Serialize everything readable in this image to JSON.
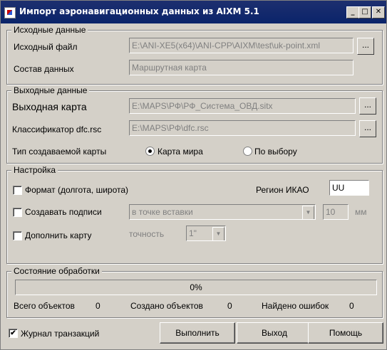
{
  "window": {
    "title": "Импорт аэронавигационных данных из AIXM 5.1",
    "controls": {
      "minimize": "_",
      "maximize": "□",
      "close": "✕"
    }
  },
  "source": {
    "group_label": "Исходные данные",
    "file_label": "Исходный файл",
    "file_value": "E:\\ANI-XE5(x64)\\ANI-CPP\\AIXM\\test\\uk-point.xml",
    "composition_label": "Состав данных",
    "composition_value": "Маршрутная карта",
    "browse_label": "..."
  },
  "output": {
    "group_label": "Выходные данные",
    "map_label": "Выходная карта",
    "map_value": "E:\\MAPS\\РФ\\РФ_Система_ОВД.sitx",
    "classifier_label": "Классификатор dfc.rsc",
    "classifier_value": "E:\\MAPS\\РФ\\dfc.rsc",
    "browse_label": "...",
    "map_type_label": "Тип создаваемой карты",
    "map_type_options": [
      "Карта мира",
      "По выбору"
    ],
    "map_type_selected": "Карта мира"
  },
  "settings": {
    "group_label": "Настройка",
    "format_label": "Формат (долгота, широта)",
    "format_checked": false,
    "region_label": "Регион ИКАО",
    "region_value": "UU",
    "labels_label": "Создавать подписи",
    "labels_checked": false,
    "labels_position": "в точке вставки",
    "labels_size": "10",
    "labels_unit": "мм",
    "supplement_label": "Дополнить карту",
    "supplement_checked": false,
    "precision_label": "точность",
    "precision_value": "1\""
  },
  "status": {
    "group_label": "Состояние обработки",
    "progress_text": "0%",
    "progress": 0,
    "total_label": "Всего объектов",
    "total_value": "0",
    "created_label": "Создано объектов",
    "created_value": "0",
    "errors_label": "Найдено ошибок",
    "errors_value": "0"
  },
  "footer": {
    "journal_label": "Журнал транзакций",
    "journal_checked": true,
    "checkmark": "✔",
    "run_label": "Выполнить",
    "exit_label": "Выход",
    "help_label": "Помощь"
  },
  "icons": {
    "combo_arrow": "▼"
  }
}
